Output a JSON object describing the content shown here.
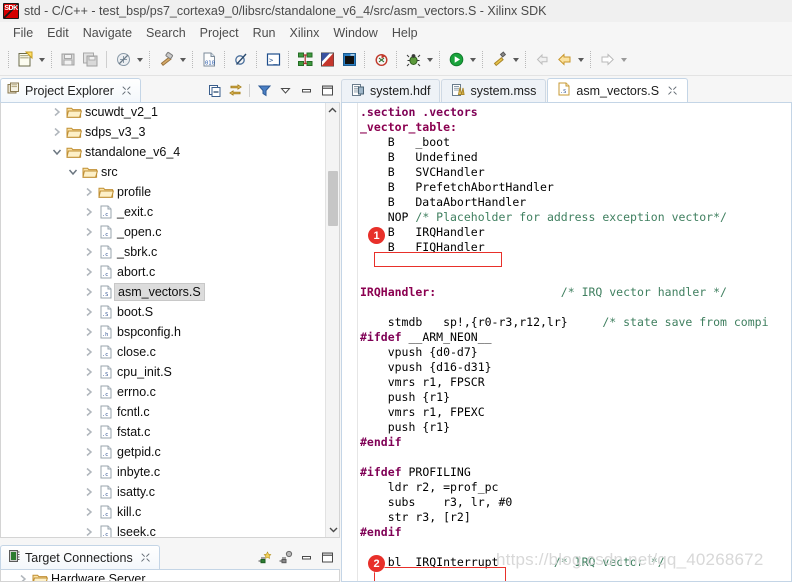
{
  "window": {
    "title": "std - C/C++ - test_bsp/ps7_cortexa9_0/libsrc/standalone_v6_4/src/asm_vectors.S - Xilinx SDK",
    "app_icon": "xilinx-sdk-icon"
  },
  "menubar": {
    "items": [
      "File",
      "Edit",
      "Navigate",
      "Search",
      "Project",
      "Run",
      "Xilinx",
      "Window",
      "Help"
    ]
  },
  "toolbar": {
    "buttons": [
      {
        "name": "new-icon",
        "label": "New"
      },
      {
        "name": "save-icon",
        "label": "Save"
      },
      {
        "name": "save-all-icon",
        "label": "Save All"
      },
      {
        "name": "build-icon",
        "label": "Build"
      },
      {
        "name": "hammer-build-icon",
        "label": "Build Project"
      },
      {
        "name": "binary-file-icon",
        "label": "Program FPGA"
      },
      {
        "name": "no-build-icon",
        "label": "Skip All Breakpoints"
      },
      {
        "name": "terminal-icon",
        "label": "Launch Terminal"
      },
      {
        "name": "system-designer-icon",
        "label": "Create Block Design"
      },
      {
        "name": "hls-icon",
        "label": "Vivado HLS"
      },
      {
        "name": "sdk-terminal-icon",
        "label": "SDK Terminal"
      },
      {
        "name": "program-flash-icon",
        "label": "Program Flash"
      },
      {
        "name": "debug-bug-icon",
        "label": "Debug"
      },
      {
        "name": "run-icon",
        "label": "Run"
      },
      {
        "name": "external-tools-icon",
        "label": "External Tools"
      },
      {
        "name": "back-icon",
        "label": "Back"
      },
      {
        "name": "previous-icon",
        "label": "Previous Annotation"
      },
      {
        "name": "next-icon",
        "label": "Next Annotation"
      }
    ]
  },
  "project_explorer": {
    "title": "Project Explorer",
    "tools": [
      {
        "name": "collapse-all-icon",
        "label": "Collapse All"
      },
      {
        "name": "link-with-editor-icon",
        "label": "Link with Editor"
      },
      {
        "name": "filter-icon",
        "label": "Filters"
      },
      {
        "name": "view-menu-icon",
        "label": "View Menu"
      },
      {
        "name": "minimize-icon",
        "label": "Minimize"
      },
      {
        "name": "maximize-icon",
        "label": "Maximize"
      }
    ],
    "tree": [
      {
        "label": "scuwdt_v2_1",
        "icon": "folder",
        "indent": 2,
        "arrow": "collapsed",
        "selected": false
      },
      {
        "label": "sdps_v3_3",
        "icon": "folder",
        "indent": 2,
        "arrow": "collapsed",
        "selected": false
      },
      {
        "label": "standalone_v6_4",
        "icon": "folder",
        "indent": 2,
        "arrow": "expanded",
        "selected": false
      },
      {
        "label": "src",
        "icon": "folder",
        "indent": 3,
        "arrow": "expanded",
        "selected": false
      },
      {
        "label": "profile",
        "icon": "folder",
        "indent": 4,
        "arrow": "collapsed",
        "selected": false
      },
      {
        "label": "_exit.c",
        "icon": "c",
        "indent": 4,
        "arrow": "collapsed",
        "selected": false
      },
      {
        "label": "_open.c",
        "icon": "c",
        "indent": 4,
        "arrow": "collapsed",
        "selected": false
      },
      {
        "label": "_sbrk.c",
        "icon": "c",
        "indent": 4,
        "arrow": "collapsed",
        "selected": false
      },
      {
        "label": "abort.c",
        "icon": "c",
        "indent": 4,
        "arrow": "collapsed",
        "selected": false
      },
      {
        "label": "asm_vectors.S",
        "icon": "s",
        "indent": 4,
        "arrow": "collapsed",
        "selected": true
      },
      {
        "label": "boot.S",
        "icon": "s",
        "indent": 4,
        "arrow": "collapsed",
        "selected": false
      },
      {
        "label": "bspconfig.h",
        "icon": "h",
        "indent": 4,
        "arrow": "collapsed",
        "selected": false
      },
      {
        "label": "close.c",
        "icon": "c",
        "indent": 4,
        "arrow": "collapsed",
        "selected": false
      },
      {
        "label": "cpu_init.S",
        "icon": "s",
        "indent": 4,
        "arrow": "collapsed",
        "selected": false
      },
      {
        "label": "errno.c",
        "icon": "c",
        "indent": 4,
        "arrow": "collapsed",
        "selected": false
      },
      {
        "label": "fcntl.c",
        "icon": "c",
        "indent": 4,
        "arrow": "collapsed",
        "selected": false
      },
      {
        "label": "fstat.c",
        "icon": "c",
        "indent": 4,
        "arrow": "collapsed",
        "selected": false
      },
      {
        "label": "getpid.c",
        "icon": "c",
        "indent": 4,
        "arrow": "collapsed",
        "selected": false
      },
      {
        "label": "inbyte.c",
        "icon": "c",
        "indent": 4,
        "arrow": "collapsed",
        "selected": false
      },
      {
        "label": "isatty.c",
        "icon": "c",
        "indent": 4,
        "arrow": "collapsed",
        "selected": false
      },
      {
        "label": "kill.c",
        "icon": "c",
        "indent": 4,
        "arrow": "collapsed",
        "selected": false
      },
      {
        "label": "lseek.c",
        "icon": "c",
        "indent": 4,
        "arrow": "collapsed",
        "selected": false
      }
    ]
  },
  "target_connections": {
    "title": "Target Connections",
    "tools": [
      {
        "name": "new-target-icon",
        "label": "New Connection"
      },
      {
        "name": "edit-target-icon",
        "label": "Edit Connection"
      },
      {
        "name": "minimize-icon",
        "label": "Minimize"
      },
      {
        "name": "maximize-icon",
        "label": "Maximize"
      }
    ],
    "tree": [
      {
        "label": "Hardware Server",
        "icon": "folder",
        "indent": 1,
        "arrow": "collapsed"
      }
    ]
  },
  "editor": {
    "tabs": [
      {
        "label": "system.hdf",
        "icon": "hdf-file-icon",
        "active": false,
        "closable": false
      },
      {
        "label": "system.mss",
        "icon": "mss-file-icon",
        "active": false,
        "closable": false
      },
      {
        "label": "asm_vectors.S",
        "icon": "asm-file-icon",
        "active": true,
        "closable": true
      }
    ],
    "lines": [
      [
        {
          "t": ".section .vectors",
          "c": "kw"
        }
      ],
      [
        {
          "t": "_vector_table:",
          "c": "lbl"
        }
      ],
      [
        {
          "t": "    B   _boot",
          "c": ""
        }
      ],
      [
        {
          "t": "    B   Undefined",
          "c": ""
        }
      ],
      [
        {
          "t": "    B   SVCHandler",
          "c": ""
        }
      ],
      [
        {
          "t": "    B   PrefetchAbortHandler",
          "c": ""
        }
      ],
      [
        {
          "t": "    B   DataAbortHandler",
          "c": ""
        }
      ],
      [
        {
          "t": "    NOP ",
          "c": ""
        },
        {
          "t": "/* Placeholder for address exception vector*/",
          "c": "cm"
        }
      ],
      [
        {
          "t": "    B   IRQHandler",
          "c": ""
        }
      ],
      [
        {
          "t": "    B   FIQHandler",
          "c": ""
        }
      ],
      [
        {
          "t": "",
          "c": ""
        }
      ],
      [
        {
          "t": "",
          "c": ""
        }
      ],
      [
        {
          "t": "IRQHandler:",
          "c": "lbl"
        },
        {
          "t": "                  ",
          "c": ""
        },
        {
          "t": "/* IRQ vector handler */",
          "c": "cm"
        }
      ],
      [
        {
          "t": "",
          "c": ""
        }
      ],
      [
        {
          "t": "    stmdb   sp!,{r0-r3,r12,lr}     ",
          "c": ""
        },
        {
          "t": "/* state save from compi",
          "c": "cm"
        }
      ],
      [
        {
          "t": "#ifdef",
          "c": "pp"
        },
        {
          "t": " __ARM_NEON__",
          "c": ""
        }
      ],
      [
        {
          "t": "    vpush {d0-d7}",
          "c": ""
        }
      ],
      [
        {
          "t": "    vpush {d16-d31}",
          "c": ""
        }
      ],
      [
        {
          "t": "    vmrs r1, FPSCR",
          "c": ""
        }
      ],
      [
        {
          "t": "    push {r1}",
          "c": ""
        }
      ],
      [
        {
          "t": "    vmrs r1, FPEXC",
          "c": ""
        }
      ],
      [
        {
          "t": "    push {r1}",
          "c": ""
        }
      ],
      [
        {
          "t": "#endif",
          "c": "pp"
        }
      ],
      [
        {
          "t": "",
          "c": ""
        }
      ],
      [
        {
          "t": "#ifdef",
          "c": "pp"
        },
        {
          "t": " PROFILING",
          "c": ""
        }
      ],
      [
        {
          "t": "    ldr r2, =prof_pc",
          "c": ""
        }
      ],
      [
        {
          "t": "    subs    r3, lr, #0",
          "c": ""
        }
      ],
      [
        {
          "t": "    str r3, [r2]",
          "c": ""
        }
      ],
      [
        {
          "t": "#endif",
          "c": "pp"
        }
      ],
      [
        {
          "t": "",
          "c": ""
        }
      ],
      [
        {
          "t": "    bl  IRQInterrupt",
          "c": ""
        },
        {
          "t": "        ",
          "c": ""
        },
        {
          "t": "/* IRQ vector */",
          "c": "cm"
        }
      ]
    ]
  },
  "annotations": [
    {
      "number": "1",
      "target": "B IRQHandler"
    },
    {
      "number": "2",
      "target": "bl IRQInterrupt"
    }
  ],
  "watermark": {
    "text": "https://blog.csdn.net/qq_40268672"
  }
}
